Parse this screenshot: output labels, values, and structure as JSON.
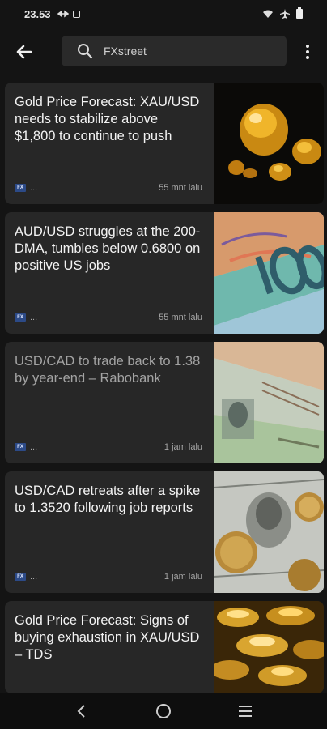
{
  "status_bar": {
    "time": "23.53"
  },
  "search": {
    "query": "FXstreet"
  },
  "articles": [
    {
      "title": "Gold Price Forecast: XAU/USD needs to stabilize above $1,800 to continue to push",
      "source": "...",
      "time": "55 mnt lalu",
      "read": false,
      "image_icon": "gold-nuggets-image"
    },
    {
      "title": "AUD/USD struggles at the 200-DMA, tumbles below 0.6800 on positive US jobs",
      "source": "...",
      "time": "55 mnt lalu",
      "read": false,
      "image_icon": "australian-dollar-image"
    },
    {
      "title": "USD/CAD to trade back to 1.38 by year-end – Rabobank",
      "source": "...",
      "time": "1 jam lalu",
      "read": true,
      "image_icon": "canadian-dollar-image"
    },
    {
      "title": "USD/CAD retreats after a spike to 1.3520 following job reports",
      "source": "...",
      "time": "1 jam lalu",
      "read": false,
      "image_icon": "us-dollar-coins-image"
    },
    {
      "title": "Gold Price Forecast: Signs of buying exhaustion in XAU/USD – TDS",
      "source": "",
      "time": "",
      "read": false,
      "image_icon": "gold-ingots-image"
    }
  ]
}
